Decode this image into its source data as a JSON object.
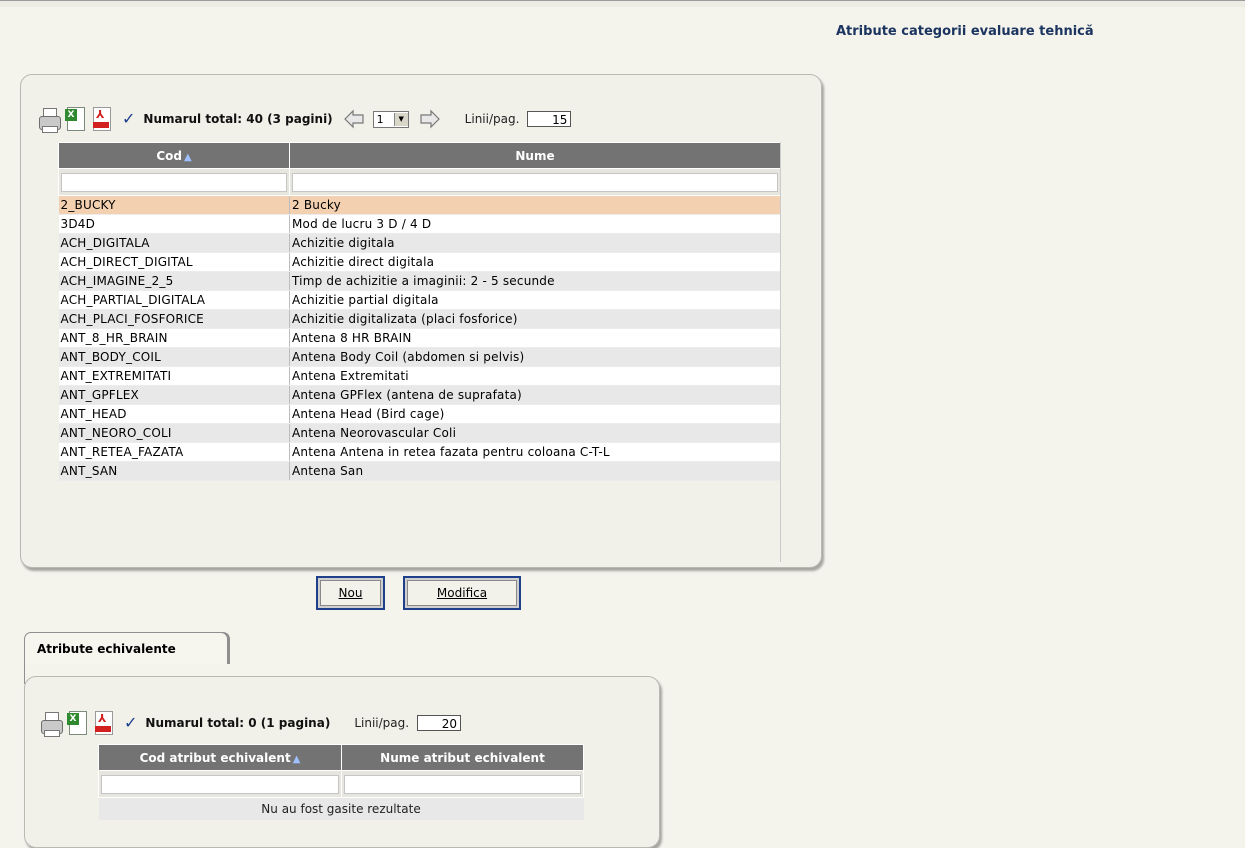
{
  "page": {
    "title": "Atribute categorii evaluare tehnică"
  },
  "main_grid": {
    "total_text": "Numarul total: 40 (3 pagini)",
    "page_select_value": "1",
    "lines_label": "Linii/pag.",
    "lines_value": "15",
    "columns": [
      "Cod",
      "Nume"
    ],
    "rows": [
      {
        "cod": "2_BUCKY",
        "nume": "2 Bucky"
      },
      {
        "cod": "3D4D",
        "nume": "Mod de lucru 3 D / 4 D"
      },
      {
        "cod": "ACH_DIGITALA",
        "nume": "Achizitie digitala"
      },
      {
        "cod": "ACH_DIRECT_DIGITAL",
        "nume": "Achizitie direct digitala"
      },
      {
        "cod": "ACH_IMAGINE_2_5",
        "nume": "Timp de achizitie a imaginii: 2 - 5 secunde"
      },
      {
        "cod": "ACH_PARTIAL_DIGITALA",
        "nume": "Achizitie partial digitala"
      },
      {
        "cod": "ACH_PLACI_FOSFORICE",
        "nume": "Achizitie digitalizata (placi fosforice)"
      },
      {
        "cod": "ANT_8_HR_BRAIN",
        "nume": "Antena 8 HR BRAIN"
      },
      {
        "cod": "ANT_BODY_COIL",
        "nume": "Antena Body Coil (abdomen si pelvis)"
      },
      {
        "cod": "ANT_EXTREMITATI",
        "nume": "Antena Extremitati"
      },
      {
        "cod": "ANT_GPFLEX",
        "nume": "Antena GPFlex (antena de suprafata)"
      },
      {
        "cod": "ANT_HEAD",
        "nume": "Antena Head (Bird cage)"
      },
      {
        "cod": "ANT_NEORO_COLI",
        "nume": "Antena Neorovascular Coli"
      },
      {
        "cod": "ANT_RETEA_FAZATA",
        "nume": "Antena Antena in retea fazata pentru coloana C-T-L"
      },
      {
        "cod": "ANT_SAN",
        "nume": "Antena San"
      }
    ]
  },
  "buttons": {
    "nou": "Nou",
    "modifica": "Modifica"
  },
  "tab": {
    "label": "Atribute echivalente"
  },
  "eq_grid": {
    "total_text": "Numarul total: 0 (1 pagina)",
    "lines_label": "Linii/pag.",
    "lines_value": "20",
    "columns": [
      "Cod atribut echivalent",
      "Nume atribut echivalent"
    ],
    "empty_text": "Nu au fost gasite rezultate"
  }
}
